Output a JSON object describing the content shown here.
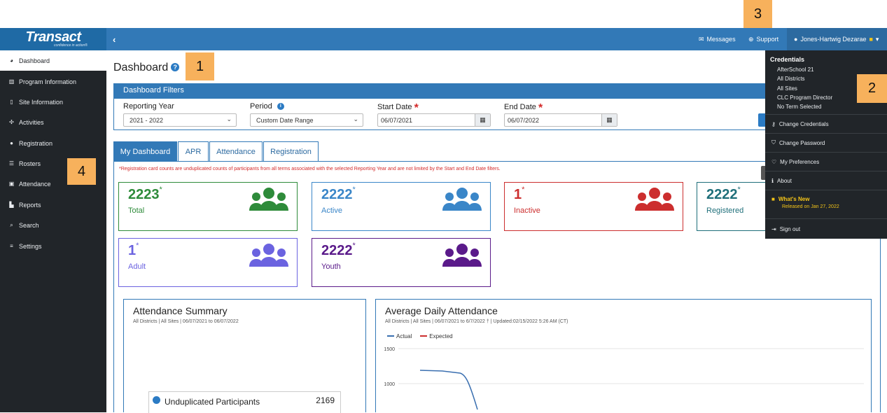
{
  "callouts": [
    "1",
    "2",
    "3",
    "4"
  ],
  "logo": {
    "text": "Transact",
    "tagline": "confidence in action®"
  },
  "topbar": {
    "collapse_icon": "chevron-left-icon",
    "messages": "Messages",
    "support": "Support",
    "user": "Jones-Hartwig Dezarae"
  },
  "sidebar": {
    "items": [
      {
        "label": "Dashboard",
        "icon": "dashboard-icon"
      },
      {
        "label": "Program Information",
        "icon": "bank-icon"
      },
      {
        "label": "Site Information",
        "icon": "building-icon"
      },
      {
        "label": "Activities",
        "icon": "activities-icon"
      },
      {
        "label": "Registration",
        "icon": "users-icon"
      },
      {
        "label": "Rosters",
        "icon": "list-icon"
      },
      {
        "label": "Attendance",
        "icon": "calendar-icon"
      },
      {
        "label": "Reports",
        "icon": "bar-chart-icon"
      },
      {
        "label": "Search",
        "icon": "search-icon"
      },
      {
        "label": "Settings",
        "icon": "sliders-icon"
      }
    ]
  },
  "page": {
    "title": "Dashboard"
  },
  "filters": {
    "header": "Dashboard Filters",
    "reporting_year_label": "Reporting Year",
    "reporting_year_value": "2021 - 2022",
    "period_label": "Period",
    "period_value": "Custom Date Range",
    "start_date_label": "Start Date",
    "start_date_value": "06/07/2021",
    "end_date_label": "End Date",
    "end_date_value": "06/07/2022",
    "required_mark": "*"
  },
  "tabs": [
    "My Dashboard",
    "APR",
    "Attendance",
    "Registration"
  ],
  "note": "*Registration card counts are unduplicated counts of participants from all terms associated with the selected Reporting Year and are not limited by the Start and End Date filters.",
  "cards": [
    {
      "value": "2223",
      "label": "Total",
      "color": "#2e8b3a"
    },
    {
      "value": "2222",
      "label": "Active",
      "color": "#3a86c8"
    },
    {
      "value": "1",
      "label": "Inactive",
      "color": "#cc2e2e"
    },
    {
      "value": "2222",
      "label": "Registered",
      "color": "#1f6f7a"
    },
    {
      "value": "1",
      "label": "Adult",
      "color": "#6b63e0"
    },
    {
      "value": "2222",
      "label": "Youth",
      "color": "#5a1a8a"
    }
  ],
  "attendance_summary": {
    "title": "Attendance Summary",
    "subtitle": "All Districts | All Sites | 06/07/2021 to 06/07/2022",
    "legend_label": "Unduplicated Participants",
    "legend_value": "2169",
    "legend_color": "#2b7bc4"
  },
  "avg_daily": {
    "title": "Average Daily Attendance",
    "subtitle": "All Districts | All Sites | 06/07/2021 to 6/7/2022 † | Updated:02/15/2022 5:26 AM (CT)"
  },
  "chart_data": {
    "type": "line",
    "title": "Average Daily Attendance",
    "series": [
      {
        "name": "Actual",
        "color": "#3a6fb0",
        "x": [
          0,
          1,
          2,
          3
        ],
        "values": [
          1190,
          1180,
          1150,
          630
        ]
      },
      {
        "name": "Expected",
        "color": "#cc2e2e",
        "x": [],
        "values": []
      }
    ],
    "y_ticks": [
      "1500",
      "1000"
    ],
    "ylim": [
      500,
      1500
    ],
    "legend_placement": "top-left"
  },
  "user_menu": {
    "credentials_header": "Credentials",
    "credentials": [
      "AfterSchool 21",
      "All Districts",
      "All Sites",
      "CLC Program Director",
      "No Term Selected"
    ],
    "items": [
      {
        "label": "Change Credentials",
        "icon": "key-icon"
      },
      {
        "label": "Change Password",
        "icon": "shield-icon"
      },
      {
        "label": "My Preferences",
        "icon": "heart-icon"
      },
      {
        "label": "About",
        "icon": "info-icon"
      }
    ],
    "whats_new": "What's New",
    "released": "Released on Jan 27, 2022",
    "sign_out": "Sign out",
    "highlight_color": "#f5c518"
  }
}
